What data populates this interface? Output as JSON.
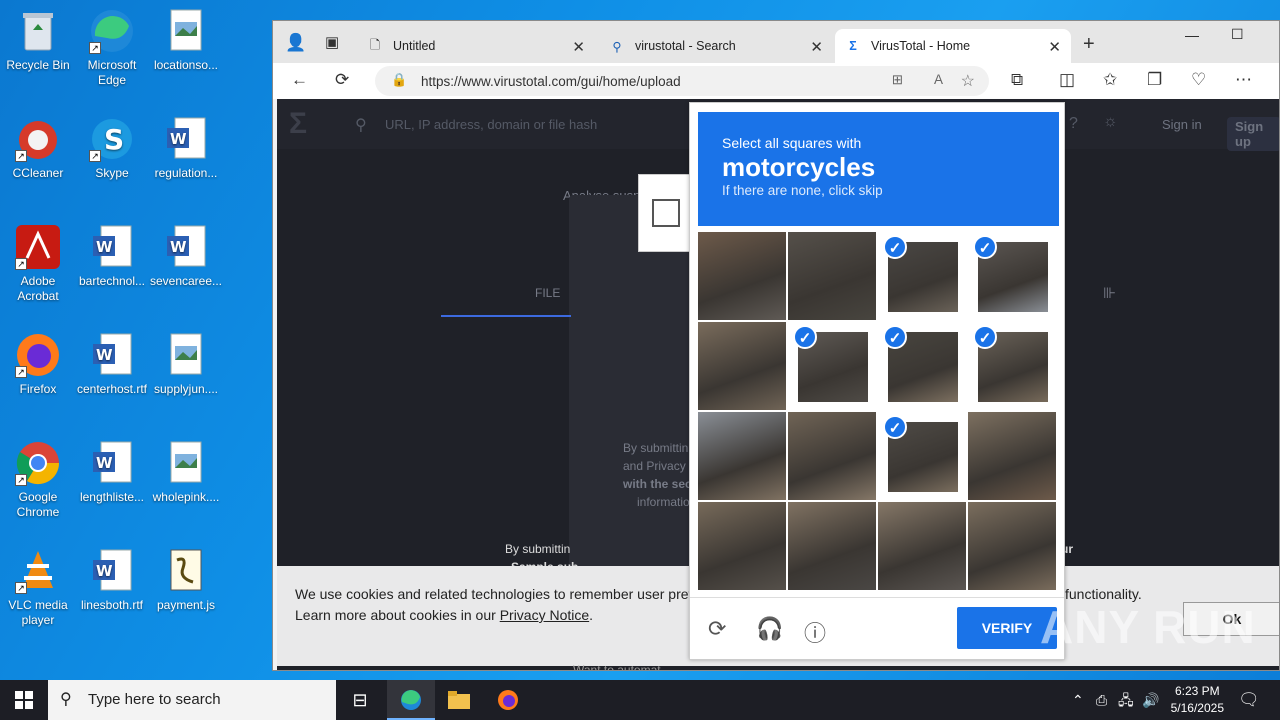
{
  "desktop": {
    "icons": [
      {
        "label": "Recycle Bin"
      },
      {
        "label": "Microsoft Edge"
      },
      {
        "label": "locationso..."
      },
      {
        "label": "CCleaner"
      },
      {
        "label": "Skype"
      },
      {
        "label": "regulation..."
      },
      {
        "label": "Adobe Acrobat"
      },
      {
        "label": "bartechnol..."
      },
      {
        "label": "sevencaree..."
      },
      {
        "label": "Firefox"
      },
      {
        "label": "centerhost.rtf"
      },
      {
        "label": "supplyjun...."
      },
      {
        "label": "Google Chrome"
      },
      {
        "label": "lengthliste..."
      },
      {
        "label": "wholepink...."
      },
      {
        "label": "VLC media player"
      },
      {
        "label": "linesboth.rtf"
      },
      {
        "label": "payment.js"
      }
    ]
  },
  "browser": {
    "tabs": [
      {
        "label": "Untitled",
        "icon": "page-icon"
      },
      {
        "label": "virustotal - Search",
        "icon": "search-icon"
      },
      {
        "label": "VirusTotal - Home",
        "icon": "virustotal-icon"
      }
    ],
    "url": "https://www.virustotal.com/gui/home/upload"
  },
  "page": {
    "search_placeholder": "URL, IP address, domain or file hash",
    "sign_in": "Sign in",
    "sign_up": "Sign up",
    "analyse_text": "Analyse suspicious fi",
    "file_tab": "FILE",
    "submit_text_1": "By submittin",
    "submit_text_2": "and Privacy N",
    "submit_text_3": "with the sec",
    "submit_text_4": "informatio",
    "bottom_text_1": "By submittin",
    "bottom_text_2": "Sample sub",
    "bottom_right_1": "ur",
    "cookie_text_1": "We use cookies and related technologies to remember user prefer",
    "cookie_text_1b": "functionality.",
    "cookie_text_2": "Learn more about cookies in our",
    "privacy_notice": "Privacy Notice",
    "cookie_text_2_end": ".",
    "ok_label": "Ok",
    "automate_text": "Want to automat"
  },
  "captcha": {
    "line1": "Select all squares with",
    "line2": "motorcycles",
    "line3": "If there are none, click skip",
    "verify_label": "VERIFY",
    "selected": [
      false,
      false,
      true,
      true,
      false,
      true,
      true,
      true,
      false,
      false,
      true,
      false,
      false,
      false,
      false,
      false
    ],
    "accent": "#1a73e8"
  },
  "watermark": "ANY RUN",
  "taskbar": {
    "search_placeholder": "Type here to search",
    "time": "6:23 PM",
    "date": "5/16/2025"
  }
}
